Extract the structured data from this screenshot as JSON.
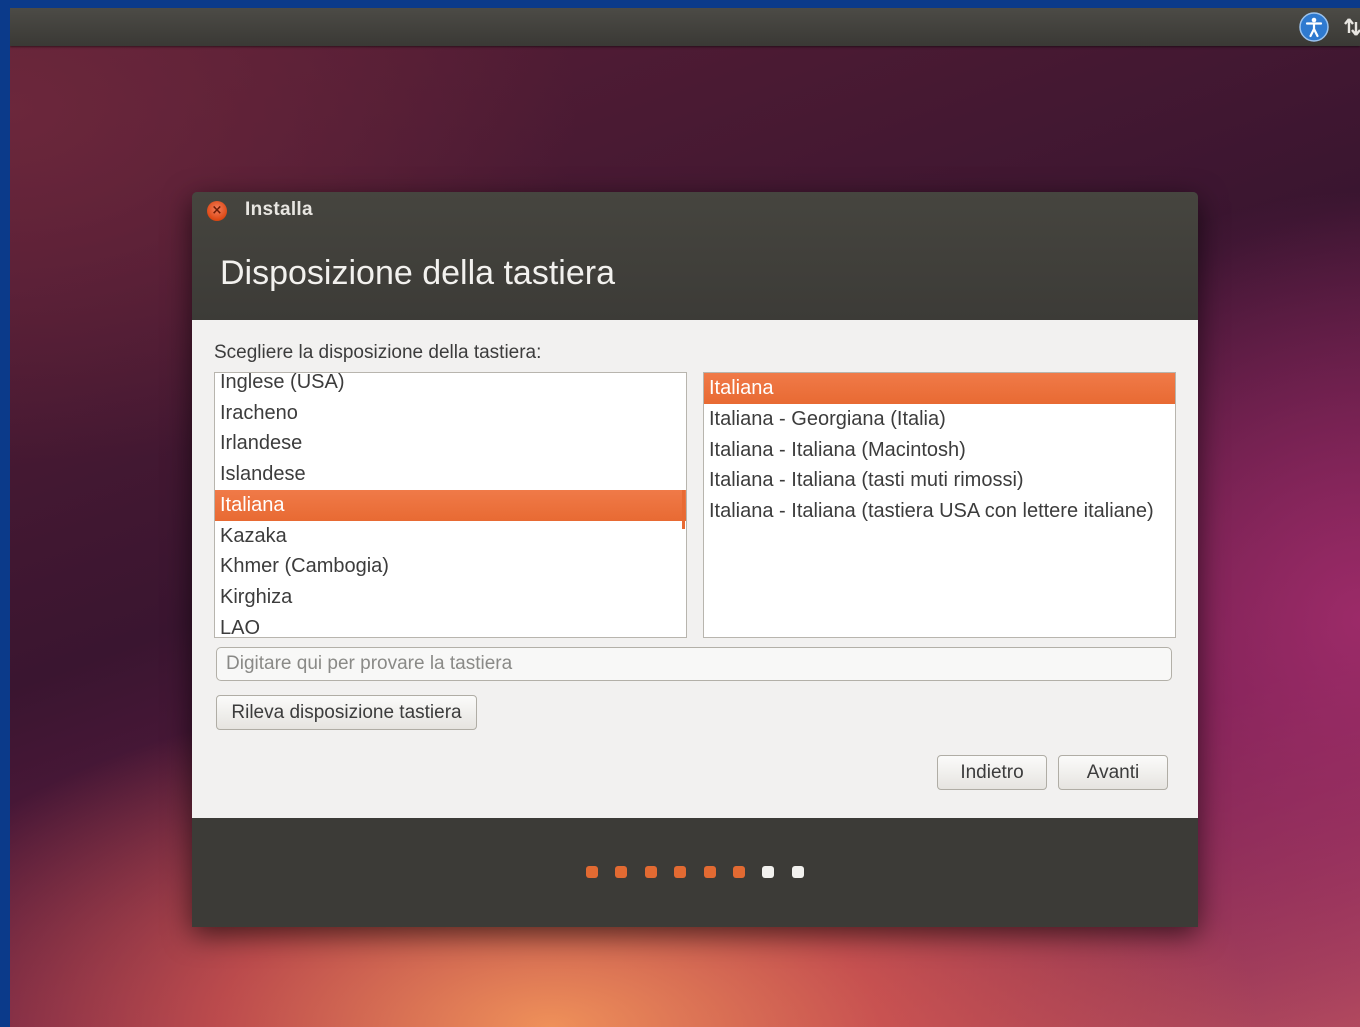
{
  "window": {
    "title": "Installa",
    "page_title": "Disposizione della tastiera"
  },
  "prompt": "Scegliere la disposizione della tastiera:",
  "layouts": [
    {
      "label": "Inglese (USA)",
      "selected": false
    },
    {
      "label": "Iracheno",
      "selected": false
    },
    {
      "label": "Irlandese",
      "selected": false
    },
    {
      "label": "Islandese",
      "selected": false
    },
    {
      "label": "Italiana",
      "selected": true
    },
    {
      "label": "Kazaka",
      "selected": false
    },
    {
      "label": "Khmer (Cambogia)",
      "selected": false
    },
    {
      "label": "Kirghiza",
      "selected": false
    },
    {
      "label": "LAO",
      "selected": false
    }
  ],
  "variants": [
    {
      "label": "Italiana",
      "selected": true
    },
    {
      "label": "Italiana - Georgiana (Italia)",
      "selected": false
    },
    {
      "label": "Italiana - Italiana (Macintosh)",
      "selected": false
    },
    {
      "label": "Italiana - Italiana (tasti muti rimossi)",
      "selected": false
    },
    {
      "label": "Italiana - Italiana (tastiera USA con lettere italiane)",
      "selected": false
    }
  ],
  "test_field": {
    "placeholder": "Digitare qui per provare la tastiera",
    "value": ""
  },
  "buttons": {
    "detect": "Rileva disposizione tastiera",
    "back": "Indietro",
    "next": "Avanti"
  },
  "progress": {
    "completed_steps": 6,
    "total_steps": 8
  },
  "panel_icons": [
    "accessibility-icon",
    "network-icon"
  ],
  "colors": {
    "accent": "#e86a33",
    "header": "#3c3b37",
    "content_bg": "#f2f1f0",
    "top_panel": "#3f3e3a"
  }
}
